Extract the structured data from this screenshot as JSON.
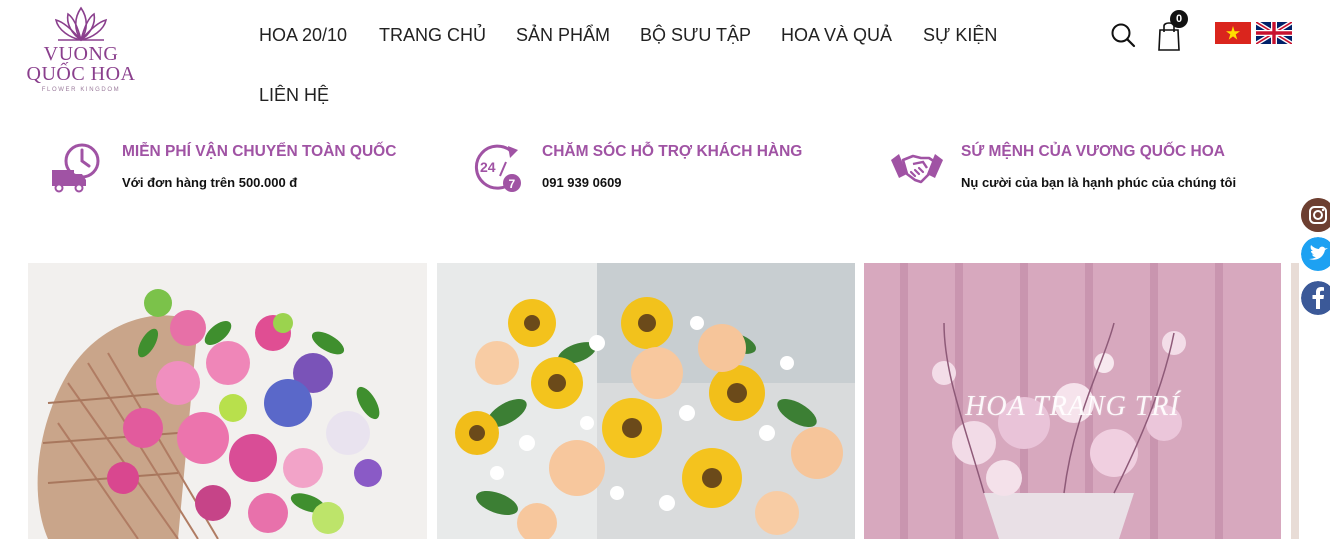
{
  "brand": {
    "line1": "VUONG",
    "line2": "QUỐC HOA",
    "tagline": "FLOWER KINGDOM",
    "color": "#8a3f8d"
  },
  "nav": {
    "items": [
      "HOA 20/10",
      "TRANG CHỦ",
      "SẢN PHẨM",
      "BỘ SƯU TẬP",
      "HOA VÀ QUẢ",
      "SỰ KIỆN",
      "LIÊN HỆ"
    ]
  },
  "header": {
    "search_icon": "search-icon",
    "cart_icon": "shopping-bag-icon",
    "cart_count": "0",
    "languages": [
      "vietnamese-flag",
      "english-flag"
    ]
  },
  "features": [
    {
      "icon": "clock-truck-icon",
      "title": "MIỄN PHÍ VẬN CHUYỂN TOÀN QUỐC",
      "desc": "Với đơn hàng trên 500.000 đ"
    },
    {
      "icon": "support-24-7-icon",
      "title": "CHĂM SÓC HỖ TRỢ KHÁCH HÀNG",
      "desc": "091 939 0609"
    },
    {
      "icon": "handshake-icon",
      "title": "SỨ MỆNH CỦA VƯƠNG QUỐC HOA",
      "desc": "Nụ cười của bạn là hạnh phúc của chúng tôi"
    }
  ],
  "social": [
    "instagram-icon",
    "twitter-icon",
    "facebook-icon"
  ],
  "gallery": [
    {
      "name": "bouquet-image",
      "caption": ""
    },
    {
      "name": "sunflower-basket-image",
      "caption": ""
    },
    {
      "name": "decor-flowers-image",
      "caption": "HOA TRANG TRÍ"
    }
  ],
  "colors": {
    "accent": "#a053a4",
    "text": "#222222"
  }
}
